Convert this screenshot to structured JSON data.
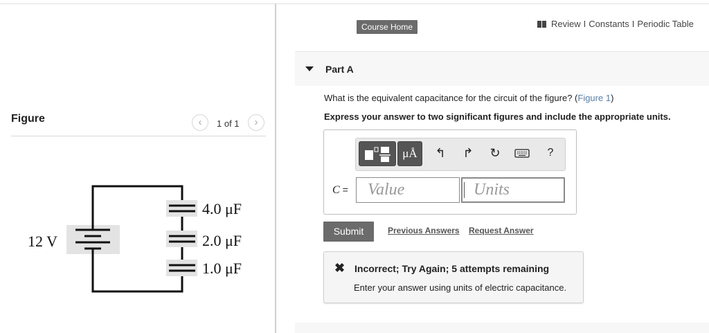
{
  "top_nav": {
    "course_home": "Course Home",
    "links": [
      "Review",
      "Constants",
      "Periodic Table"
    ],
    "separator": "I",
    "icon": "book-icon"
  },
  "figure_panel": {
    "title": "Figure",
    "pager": "1 of 1",
    "prev_icon": "chevron-left-icon",
    "next_icon": "chevron-right-icon",
    "circuit": {
      "battery_label": "12 V",
      "capacitors": [
        "4.0 μF",
        "2.0 μF",
        "1.0 μF"
      ]
    }
  },
  "part_a": {
    "title": "Part A",
    "question": "What is the equivalent capacitance for the circuit of the figure? (",
    "figure_link": "Figure 1",
    "question_end": ")",
    "instruction": "Express your answer to two significant figures and include the appropriate units.",
    "toolbar": {
      "units_label": "μÅ",
      "help_label": "?",
      "icons": [
        "templates-icon",
        "units-icon",
        "undo-icon",
        "redo-icon",
        "reset-icon",
        "keyboard-icon",
        "help-icon"
      ]
    },
    "answer": {
      "variable": "C",
      "equals": "=",
      "value_placeholder": "Value",
      "units_placeholder": "Units"
    },
    "submit_label": "Submit",
    "previous_answers": "Previous Answers",
    "request_answer": "Request Answer",
    "feedback": {
      "title": "Incorrect; Try Again; 5 attempts remaining",
      "message": "Enter your answer using units of electric capacitance."
    }
  }
}
